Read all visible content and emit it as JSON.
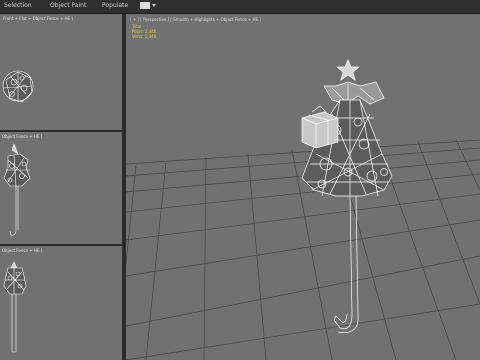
{
  "menubar": {
    "items": [
      "Selection",
      "Object Paint",
      "Populate"
    ],
    "dropdown_icon": "chevron-down-icon"
  },
  "viewports": {
    "top_label": " Front + Flat + Object Fence + HE ]",
    "front_label": "Object Fence + HE ]",
    "left_label": "Object Fence + HE ]",
    "perspective_label": "[ + ] [ Perspective ] [ Smooth + Highlights + Object Fence + HE ]"
  },
  "statistics": {
    "total": "Total",
    "polys": "Polys:  2,446",
    "verts": "Verts:  1,349"
  },
  "colors": {
    "viewport_bg": "#717171",
    "frame_bg": "#2b2b2b",
    "grid": "#4a4a4a",
    "wire": "#ffffff",
    "stats": "#e8d34a"
  }
}
